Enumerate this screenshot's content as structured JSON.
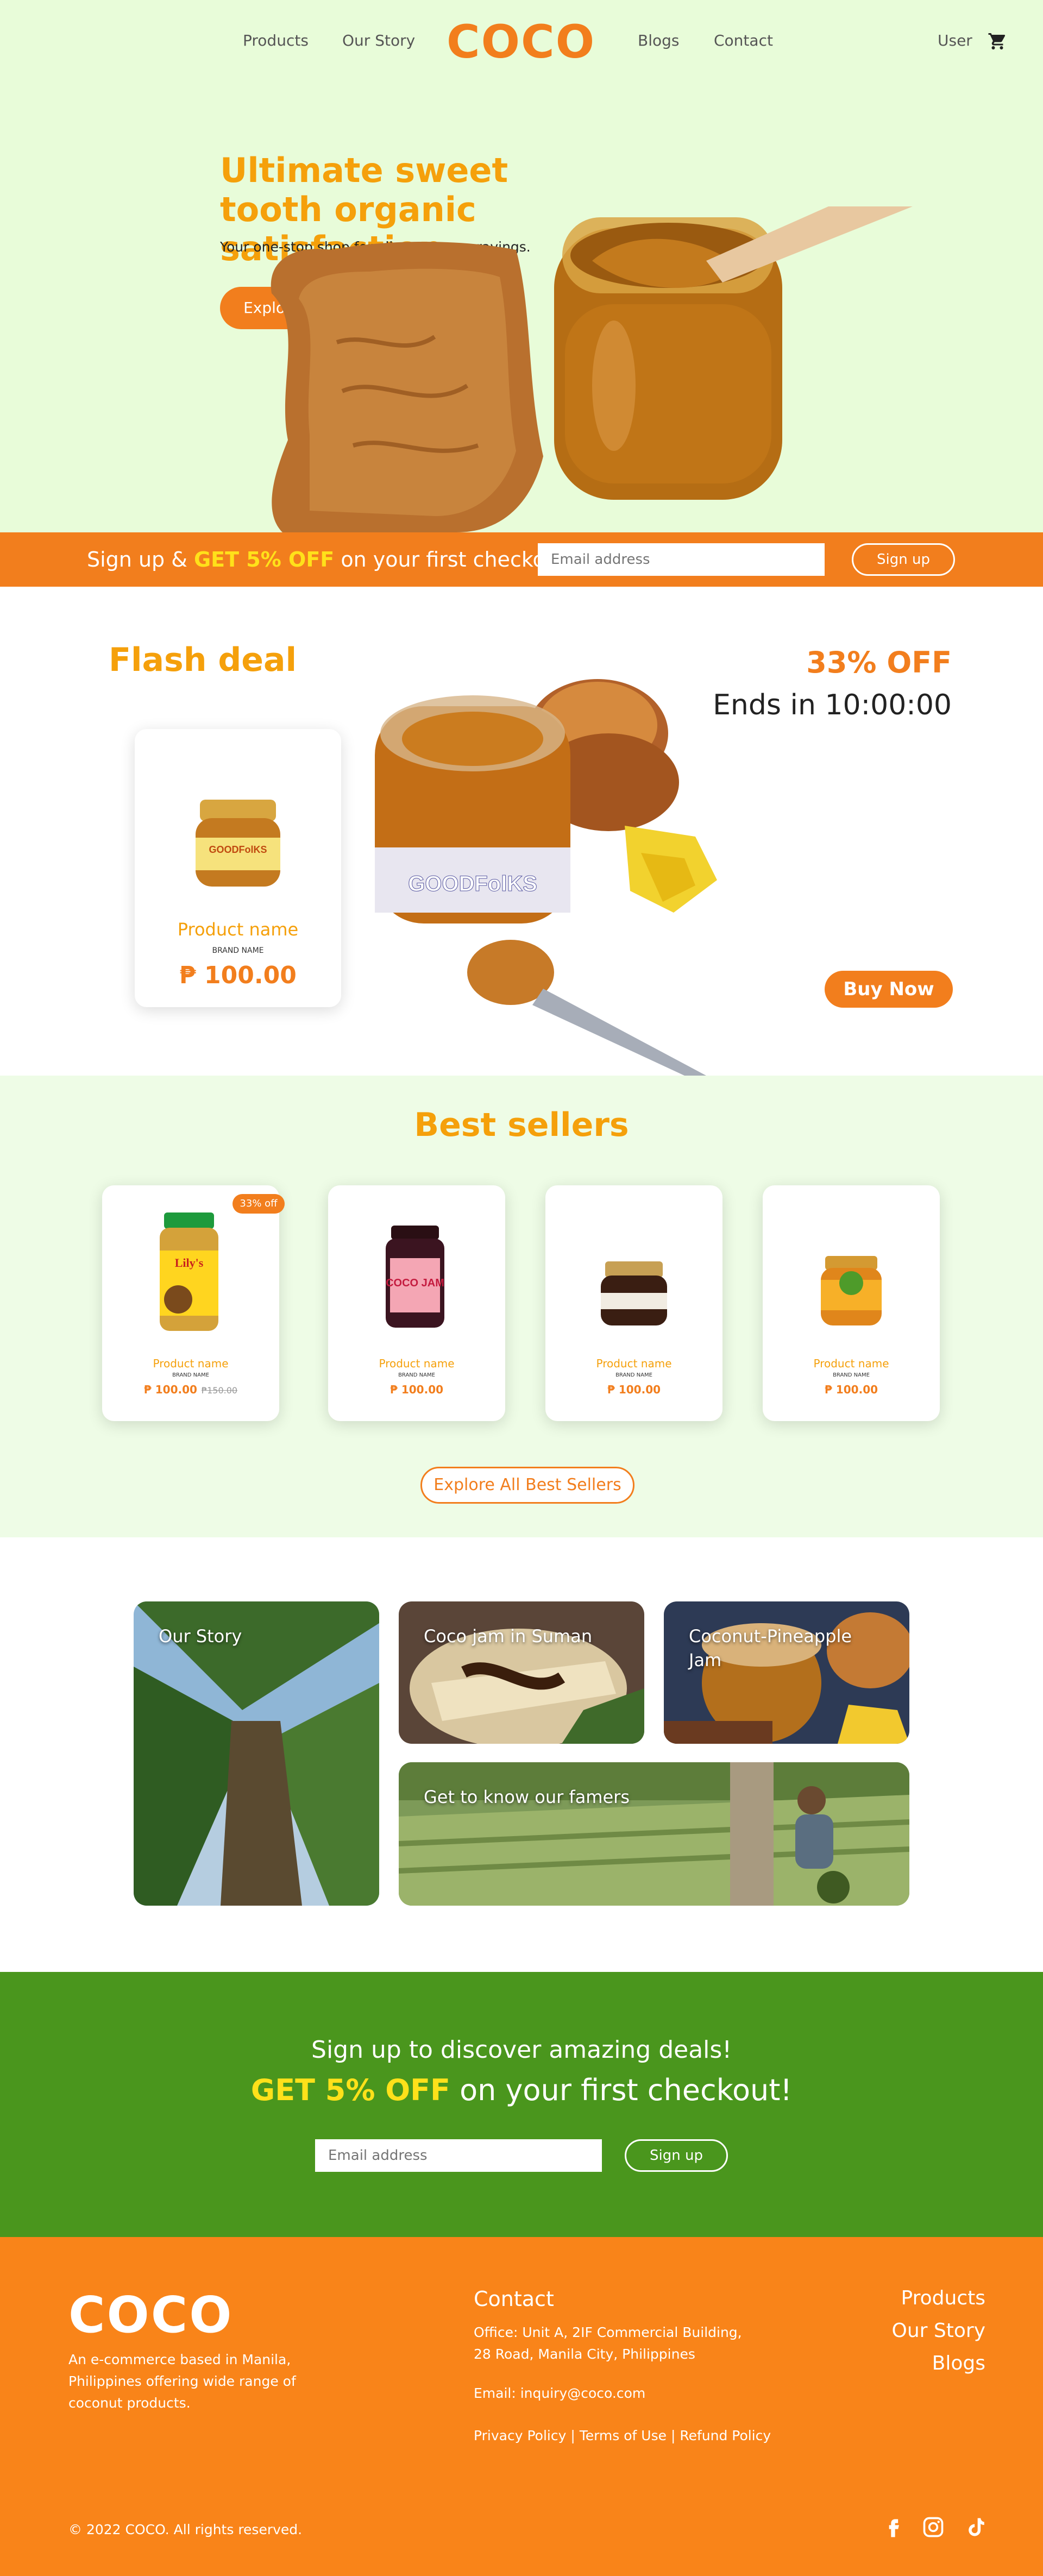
{
  "nav": {
    "logo": "COCO",
    "links": [
      "Products",
      "Our Story",
      "Blogs",
      "Contact"
    ],
    "user": "User",
    "cart_icon": "cart-icon"
  },
  "hero": {
    "title": "Ultimate sweet tooth organic satisfaction",
    "subtitle": "Your one-stop shop for all your coco-cravings.",
    "cta": "Explore selection"
  },
  "signup_bar": {
    "text_before": "Sign up & ",
    "highlight": "GET 5% OFF",
    "text_after": " on your first checkout!",
    "email_placeholder": "Email address",
    "button": "Sign up"
  },
  "flash_deal": {
    "title": "Flash deal",
    "discount": "33% OFF",
    "countdown": "Ends in 10:00:00",
    "product": {
      "name": "Product name",
      "brand": "BRAND NAME",
      "price": "₱ 100.00",
      "jar_label": "GOODFolKS"
    },
    "buy_button": "Buy Now"
  },
  "best_sellers": {
    "title": "Best sellers",
    "items": [
      {
        "name": "Product name",
        "brand": "BRAND NAME",
        "price": "₱ 100.00",
        "old_price": "₱150.00",
        "badge": "33% off",
        "jar_label": "Lily's"
      },
      {
        "name": "Product name",
        "brand": "BRAND NAME",
        "price": "₱ 100.00",
        "jar_label": "COCO JAM"
      },
      {
        "name": "Product name",
        "brand": "BRAND NAME",
        "price": "₱ 100.00"
      },
      {
        "name": "Product name",
        "brand": "BRAND NAME",
        "price": "₱ 100.00"
      }
    ],
    "explore_button": "Explore All Best Sellers"
  },
  "story": {
    "tiles": [
      "Our Story",
      "Coco jam in Suman",
      "Coconut-Pineapple Jam",
      "Get to know our famers"
    ]
  },
  "green_signup": {
    "line1": "Sign up to discover amazing deals!",
    "highlight": "GET 5% OFF",
    "line2_after": " on your first checkout!",
    "email_placeholder": "Email address",
    "button": "Sign up"
  },
  "footer": {
    "logo": "COCO",
    "description": "An e-commerce based in Manila, Philippines offering wide range of coconut products.",
    "contact_heading": "Contact",
    "address_line1": "Office: Unit A, 2IF Commercial Building,",
    "address_line2": "28 Road, Manila City, Philippines",
    "email": "Email: inquiry@coco.com",
    "policies": "Privacy Policy | Terms of Use | Refund Policy",
    "links": [
      "Products",
      "Our Story",
      "Blogs"
    ],
    "copyright": "© 2022 COCO. All rights reserved.",
    "social_icons": [
      "facebook-icon",
      "instagram-icon",
      "tiktok-icon"
    ]
  },
  "colors": {
    "orange": "#f27e1d",
    "gold": "#f5a00b",
    "mint": "#e8fcd9",
    "green": "#4a961d",
    "yellow_highlight": "#ffe11a"
  }
}
